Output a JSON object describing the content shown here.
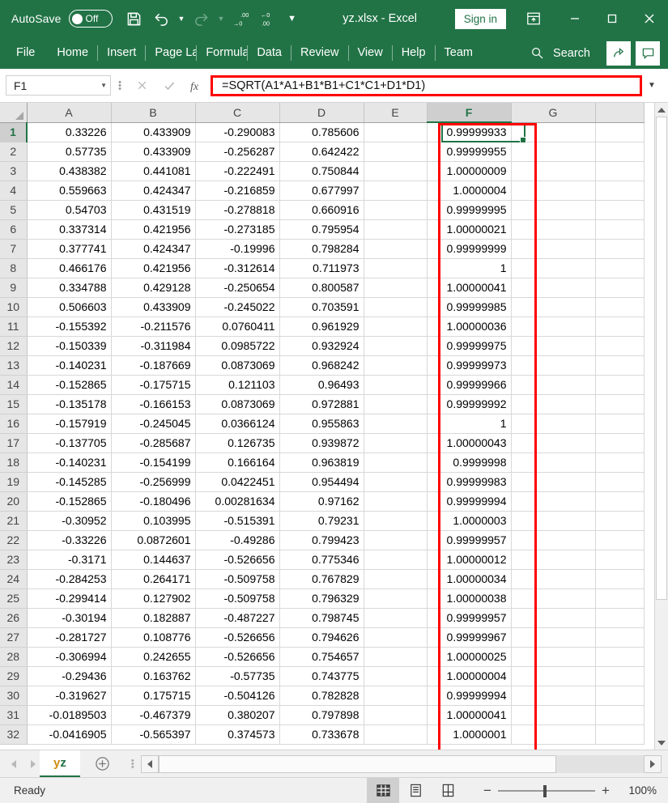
{
  "titlebar": {
    "autosave_label": "AutoSave",
    "autosave_state": "Off",
    "doc_title": "yz.xlsx  -  Excel",
    "signin_label": "Sign in",
    "qat": [
      {
        "name": "save-icon",
        "label": "Save"
      },
      {
        "name": "undo-icon",
        "label": "Undo"
      },
      {
        "name": "redo-icon",
        "label": "Redo"
      },
      {
        "name": "increase-decimal-icon",
        "label": "Increase Decimal"
      },
      {
        "name": "decrease-decimal-icon",
        "label": "Decrease Decimal"
      },
      {
        "name": "customize-quick-access-toolbar-icon",
        "label": "Customize Quick Access Toolbar"
      }
    ],
    "window": [
      {
        "name": "ribbon-display-options-icon",
        "label": "Ribbon Display Options"
      },
      {
        "name": "minimize-icon",
        "label": "Minimize"
      },
      {
        "name": "maximize-icon",
        "label": "Maximize"
      },
      {
        "name": "close-icon",
        "label": "Close"
      }
    ]
  },
  "ribbon": {
    "tabs": [
      "File",
      "Home",
      "Insert",
      "Page Lay",
      "Formulas",
      "Data",
      "Review",
      "View",
      "Help",
      "Team"
    ],
    "search_label": "Search",
    "share_label": "Share",
    "comments_label": "Comments"
  },
  "formulabar": {
    "name_box": "F1",
    "cancel_label": "Cancel",
    "enter_label": "Enter",
    "fx_label": "Insert Function",
    "formula": "=SQRT(A1*A1+B1*B1+C1*C1+D1*D1)"
  },
  "grid": {
    "columns": [
      "A",
      "B",
      "C",
      "D",
      "E",
      "F",
      "G"
    ],
    "selected_column": "F",
    "selected_cell": "F1",
    "rows": [
      {
        "n": "1",
        "A": "0.33226",
        "B": "0.433909",
        "C": "-0.290083",
        "D": "0.785606",
        "E": "",
        "F": "0.99999933",
        "G": ""
      },
      {
        "n": "2",
        "A": "0.57735",
        "B": "0.433909",
        "C": "-0.256287",
        "D": "0.642422",
        "E": "",
        "F": "0.99999955",
        "G": ""
      },
      {
        "n": "3",
        "A": "0.438382",
        "B": "0.441081",
        "C": "-0.222491",
        "D": "0.750844",
        "E": "",
        "F": "1.00000009",
        "G": ""
      },
      {
        "n": "4",
        "A": "0.559663",
        "B": "0.424347",
        "C": "-0.216859",
        "D": "0.677997",
        "E": "",
        "F": "1.0000004",
        "G": ""
      },
      {
        "n": "5",
        "A": "0.54703",
        "B": "0.431519",
        "C": "-0.278818",
        "D": "0.660916",
        "E": "",
        "F": "0.99999995",
        "G": ""
      },
      {
        "n": "6",
        "A": "0.337314",
        "B": "0.421956",
        "C": "-0.273185",
        "D": "0.795954",
        "E": "",
        "F": "1.00000021",
        "G": ""
      },
      {
        "n": "7",
        "A": "0.377741",
        "B": "0.424347",
        "C": "-0.19996",
        "D": "0.798284",
        "E": "",
        "F": "0.99999999",
        "G": ""
      },
      {
        "n": "8",
        "A": "0.466176",
        "B": "0.421956",
        "C": "-0.312614",
        "D": "0.711973",
        "E": "",
        "F": "1",
        "G": ""
      },
      {
        "n": "9",
        "A": "0.334788",
        "B": "0.429128",
        "C": "-0.250654",
        "D": "0.800587",
        "E": "",
        "F": "1.00000041",
        "G": ""
      },
      {
        "n": "10",
        "A": "0.506603",
        "B": "0.433909",
        "C": "-0.245022",
        "D": "0.703591",
        "E": "",
        "F": "0.99999985",
        "G": ""
      },
      {
        "n": "11",
        "A": "-0.155392",
        "B": "-0.211576",
        "C": "0.0760411",
        "D": "0.961929",
        "E": "",
        "F": "1.00000036",
        "G": ""
      },
      {
        "n": "12",
        "A": "-0.150339",
        "B": "-0.311984",
        "C": "0.0985722",
        "D": "0.932924",
        "E": "",
        "F": "0.99999975",
        "G": ""
      },
      {
        "n": "13",
        "A": "-0.140231",
        "B": "-0.187669",
        "C": "0.0873069",
        "D": "0.968242",
        "E": "",
        "F": "0.99999973",
        "G": ""
      },
      {
        "n": "14",
        "A": "-0.152865",
        "B": "-0.175715",
        "C": "0.121103",
        "D": "0.96493",
        "E": "",
        "F": "0.99999966",
        "G": ""
      },
      {
        "n": "15",
        "A": "-0.135178",
        "B": "-0.166153",
        "C": "0.0873069",
        "D": "0.972881",
        "E": "",
        "F": "0.99999992",
        "G": ""
      },
      {
        "n": "16",
        "A": "-0.157919",
        "B": "-0.245045",
        "C": "0.0366124",
        "D": "0.955863",
        "E": "",
        "F": "1",
        "G": ""
      },
      {
        "n": "17",
        "A": "-0.137705",
        "B": "-0.285687",
        "C": "0.126735",
        "D": "0.939872",
        "E": "",
        "F": "1.00000043",
        "G": ""
      },
      {
        "n": "18",
        "A": "-0.140231",
        "B": "-0.154199",
        "C": "0.166164",
        "D": "0.963819",
        "E": "",
        "F": "0.9999998",
        "G": ""
      },
      {
        "n": "19",
        "A": "-0.145285",
        "B": "-0.256999",
        "C": "0.0422451",
        "D": "0.954494",
        "E": "",
        "F": "0.99999983",
        "G": ""
      },
      {
        "n": "20",
        "A": "-0.152865",
        "B": "-0.180496",
        "C": "0.00281634",
        "D": "0.97162",
        "E": "",
        "F": "0.99999994",
        "G": ""
      },
      {
        "n": "21",
        "A": "-0.30952",
        "B": "0.103995",
        "C": "-0.515391",
        "D": "0.79231",
        "E": "",
        "F": "1.0000003",
        "G": ""
      },
      {
        "n": "22",
        "A": "-0.33226",
        "B": "0.0872601",
        "C": "-0.49286",
        "D": "0.799423",
        "E": "",
        "F": "0.99999957",
        "G": ""
      },
      {
        "n": "23",
        "A": "-0.3171",
        "B": "0.144637",
        "C": "-0.526656",
        "D": "0.775346",
        "E": "",
        "F": "1.00000012",
        "G": ""
      },
      {
        "n": "24",
        "A": "-0.284253",
        "B": "0.264171",
        "C": "-0.509758",
        "D": "0.767829",
        "E": "",
        "F": "1.00000034",
        "G": ""
      },
      {
        "n": "25",
        "A": "-0.299414",
        "B": "0.127902",
        "C": "-0.509758",
        "D": "0.796329",
        "E": "",
        "F": "1.00000038",
        "G": ""
      },
      {
        "n": "26",
        "A": "-0.30194",
        "B": "0.182887",
        "C": "-0.487227",
        "D": "0.798745",
        "E": "",
        "F": "0.99999957",
        "G": ""
      },
      {
        "n": "27",
        "A": "-0.281727",
        "B": "0.108776",
        "C": "-0.526656",
        "D": "0.794626",
        "E": "",
        "F": "0.99999967",
        "G": ""
      },
      {
        "n": "28",
        "A": "-0.306994",
        "B": "0.242655",
        "C": "-0.526656",
        "D": "0.754657",
        "E": "",
        "F": "1.00000025",
        "G": ""
      },
      {
        "n": "29",
        "A": "-0.29436",
        "B": "0.163762",
        "C": "-0.57735",
        "D": "0.743775",
        "E": "",
        "F": "1.00000004",
        "G": ""
      },
      {
        "n": "30",
        "A": "-0.319627",
        "B": "0.175715",
        "C": "-0.504126",
        "D": "0.782828",
        "E": "",
        "F": "0.99999994",
        "G": ""
      },
      {
        "n": "31",
        "A": "-0.0189503",
        "B": "-0.467379",
        "C": "0.380207",
        "D": "0.797898",
        "E": "",
        "F": "1.00000041",
        "G": ""
      },
      {
        "n": "32",
        "A": "-0.0416905",
        "B": "-0.565397",
        "C": "0.374573",
        "D": "0.733678",
        "E": "",
        "F": "1.0000001",
        "G": ""
      }
    ]
  },
  "tabbar": {
    "sheet_name_part1": "y",
    "sheet_name_part2": "z",
    "prev_label": "Previous Sheet",
    "next_label": "Next Sheet",
    "add_label": "New sheet"
  },
  "statusbar": {
    "status": "Ready",
    "views": [
      {
        "name": "normal-view-icon",
        "label": "Normal"
      },
      {
        "name": "page-layout-view-icon",
        "label": "Page Layout"
      },
      {
        "name": "page-break-preview-icon",
        "label": "Page Break Preview"
      }
    ],
    "zoom_out": "−",
    "zoom_in": "+",
    "zoom_percent": "100%"
  },
  "colors": {
    "brand_green": "#217346",
    "annotation_red": "#ff0000",
    "selection_green": "#217346"
  }
}
